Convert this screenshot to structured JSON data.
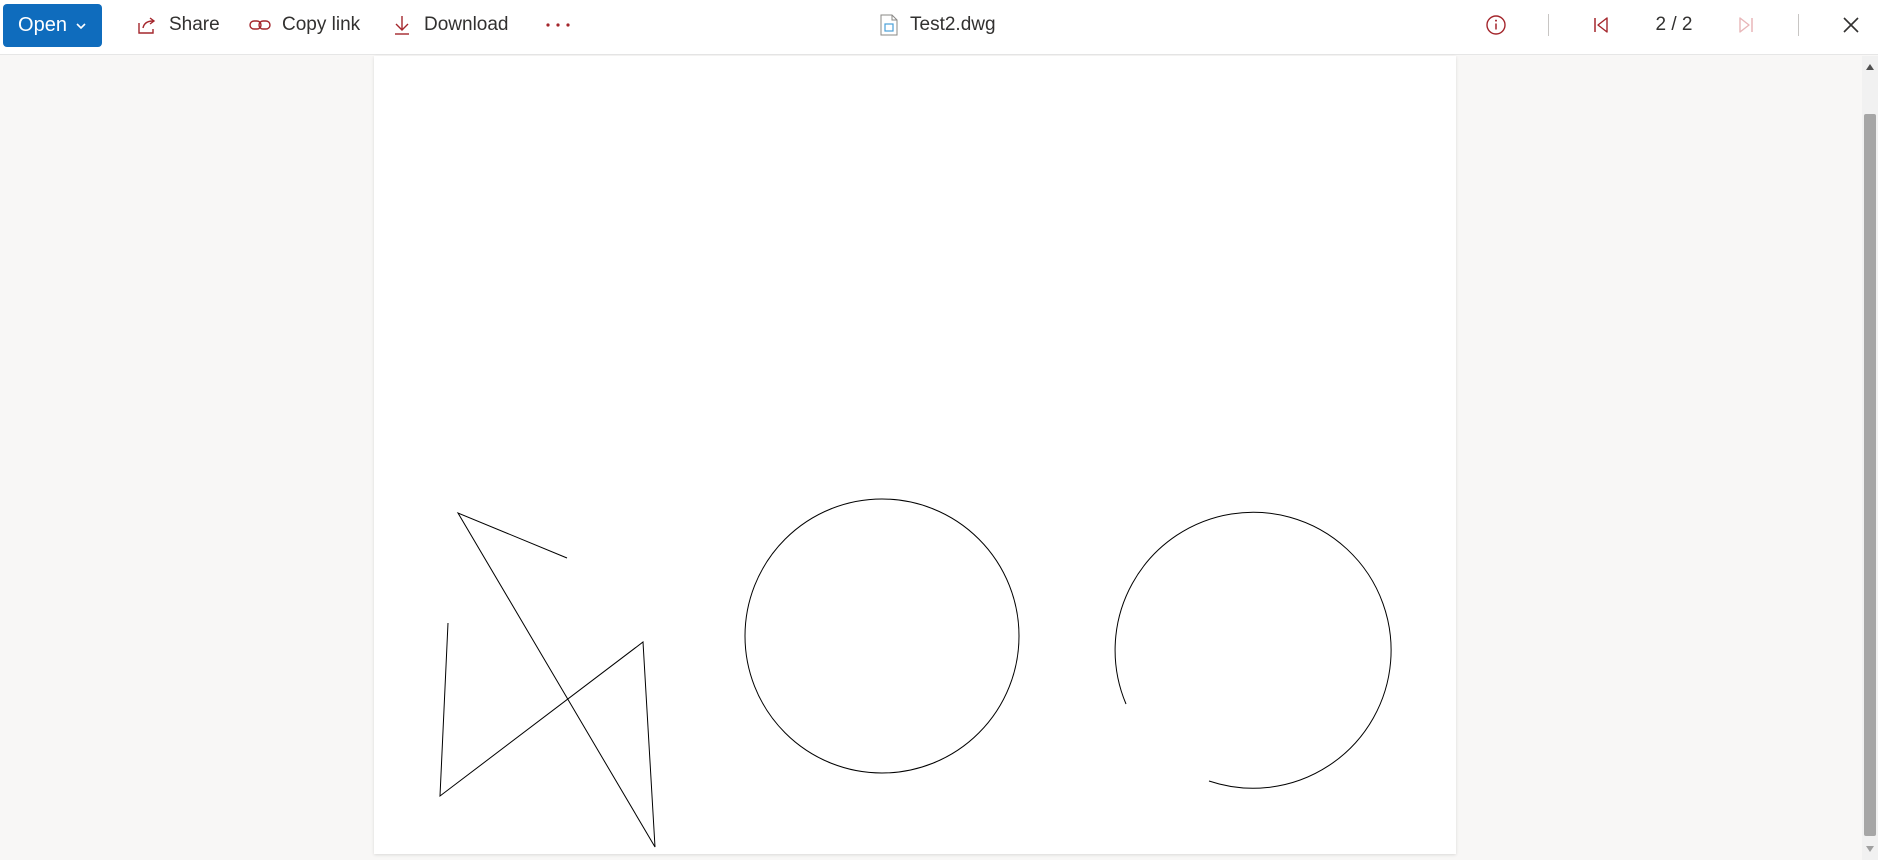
{
  "toolbar": {
    "open_label": "Open",
    "share_label": "Share",
    "copy_link_label": "Copy link",
    "download_label": "Download",
    "more_icon": "more-horizontal-icon"
  },
  "file": {
    "name": "Test2.dwg",
    "icon": "dwg-file-icon"
  },
  "pager": {
    "label": "2 / 2"
  },
  "colors": {
    "accent": "#0f6cbd",
    "icon_red": "#a4262c",
    "icon_disabled": "#e8b6b8"
  }
}
